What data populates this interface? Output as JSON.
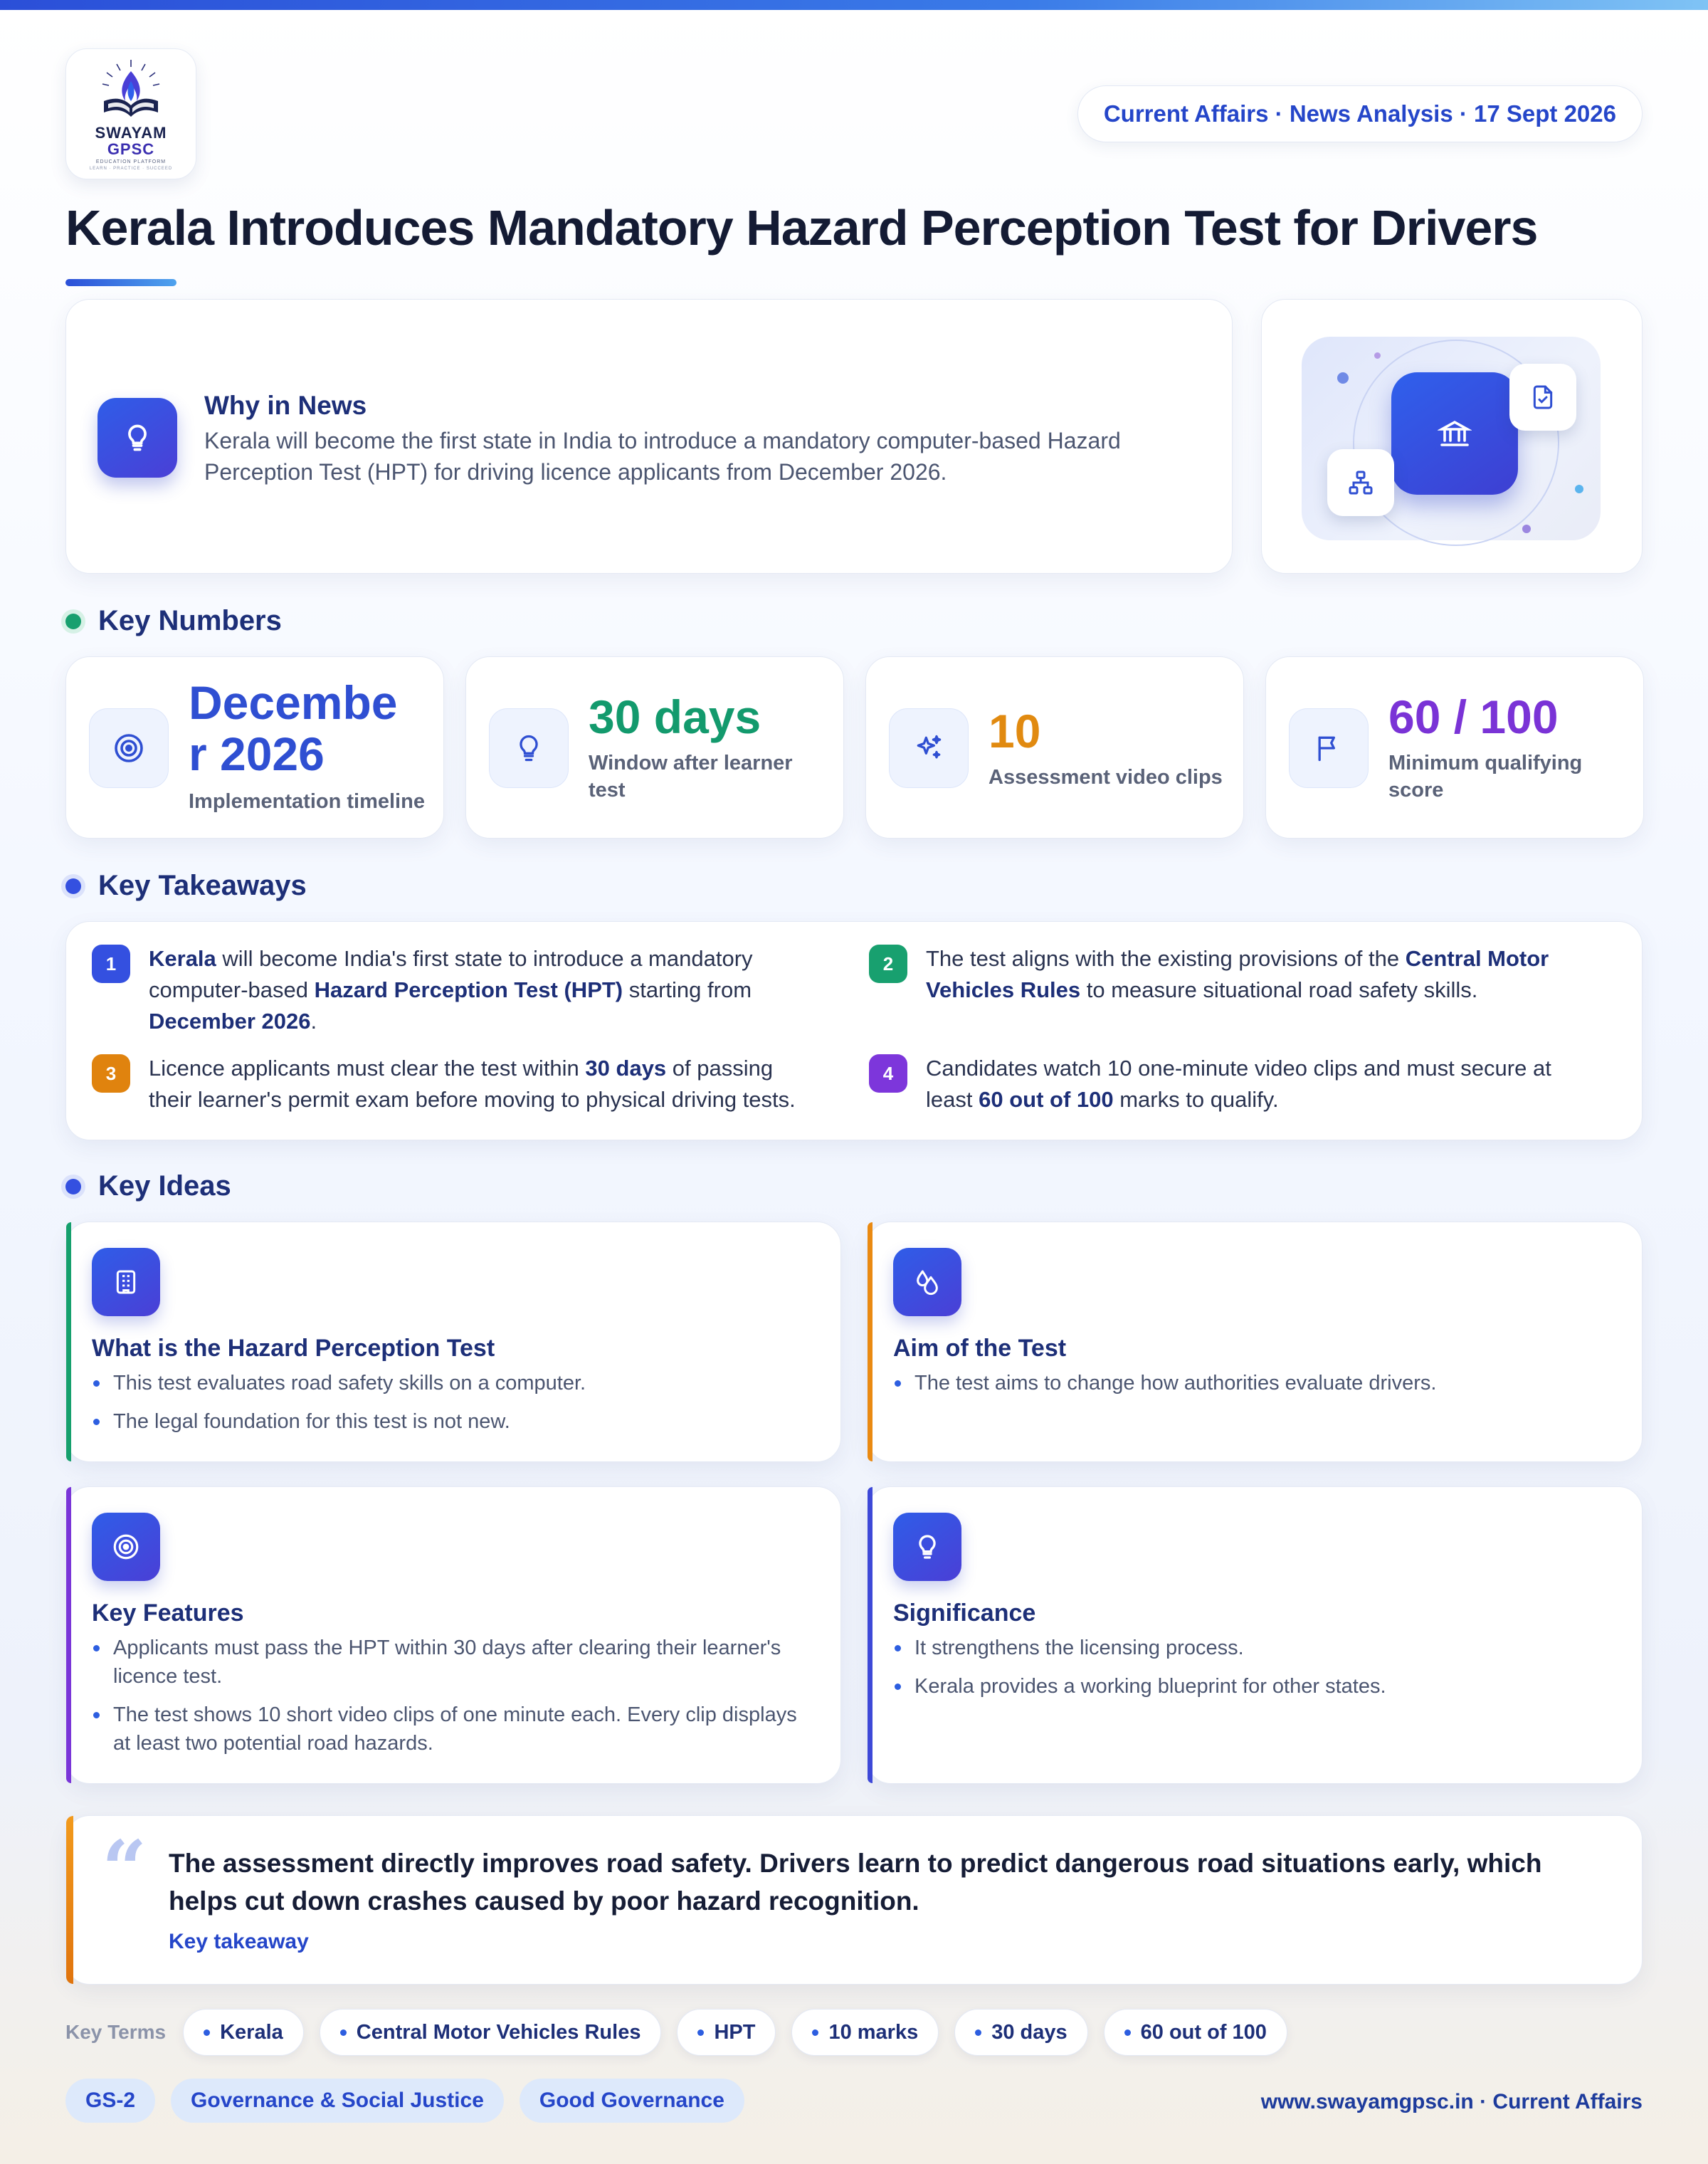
{
  "logo": {
    "line1": "SWAYAM",
    "line2": "GPSC",
    "line3": "EDUCATION PLATFORM",
    "line4": "LEARN · PRACTICE · SUCCEED"
  },
  "header": {
    "pill": "Current Affairs · News Analysis · 17 Sept 2026",
    "title": "Kerala Introduces Mandatory Hazard Perception Test for Drivers"
  },
  "why": {
    "heading": "Why in News",
    "text": "Kerala will become the first state in India to introduce a mandatory computer-based Hazard Perception Test (HPT) for driving licence applicants from December 2026."
  },
  "sections": {
    "numbers": "Key Numbers",
    "takeaways": "Key Takeaways",
    "ideas": "Key Ideas"
  },
  "numbers": [
    {
      "value_line1": "Decembe",
      "value_line2": "r 2026",
      "caption": "Implementation timeline",
      "color": "#2f4fd2",
      "icon": "target-icon"
    },
    {
      "value": "30 days",
      "caption_line1": "Window after learner",
      "caption_line2": "test",
      "color": "#139a6d",
      "icon": "lightbulb-icon"
    },
    {
      "value": "10",
      "caption": "Assessment video clips",
      "color": "#e18a10",
      "icon": "sparkle-icon"
    },
    {
      "value": "60 / 100",
      "caption_line1": "Minimum qualifying",
      "caption_line2": "score",
      "color": "#7a33d6",
      "icon": "flag-icon"
    }
  ],
  "takeaways": [
    {
      "num": "1",
      "color": "#3450e0",
      "p1": "Kerala",
      "p2": " will become India's first state to introduce a mandatory",
      "p3": "computer-based ",
      "p4": "Hazard Perception Test (HPT)",
      "p5": " starting from",
      "p6": "December 2026",
      "p7": "."
    },
    {
      "num": "2",
      "color": "#18a06f",
      "p1": "The test aligns with the existing provisions of the ",
      "p2": "Central Motor",
      "p3": "Vehicles Rules",
      "p4": " to measure situational road safety skills."
    },
    {
      "num": "3",
      "color": "#e0830e",
      "p1": "Licence applicants must clear the test within ",
      "p2": "30 days",
      "p3": " of passing",
      "p4": "their learner's permit exam before moving to physical driving tests."
    },
    {
      "num": "4",
      "color": "#7d36db",
      "p1": "Candidates watch 10 one-minute video clips and must secure at",
      "p2": "least ",
      "p3": "60 out of 100",
      "p4": " marks to qualify."
    }
  ],
  "ideas": [
    {
      "title": "What is the Hazard Perception Test",
      "stripe": "#16a06d",
      "icon": "building-icon",
      "bullets": [
        "This test evaluates road safety skills on a computer.",
        "The legal foundation for this test is not new."
      ]
    },
    {
      "title": "Aim of the Test",
      "stripe": "#ea8a12",
      "icon": "drops-icon",
      "bullets": [
        "The test aims to change how authorities evaluate drivers."
      ]
    },
    {
      "title": "Key Features",
      "stripe": "#7a35d8",
      "icon": "target-icon",
      "bullets": [
        "Applicants must pass the HPT within 30 days after clearing their learner's licence test.",
        "The test shows 10 short video clips of one minute each. Every clip displays at least two potential road hazards."
      ]
    },
    {
      "title": "Significance",
      "stripe": "#3e49d8",
      "icon": "lightbulb-icon",
      "bullets": [
        "It strengthens the licensing process.",
        "Kerala provides a working blueprint for other states."
      ]
    }
  ],
  "quote": {
    "text": "The assessment directly improves road safety. Drivers learn to predict dangerous road situations early, which helps cut down crashes caused by poor hazard recognition.",
    "source": "Key takeaway"
  },
  "key_terms": {
    "label": "Key Terms",
    "items": [
      "Kerala",
      "Central Motor Vehicles Rules",
      "HPT",
      "10 marks",
      "30 days",
      "60 out of 100"
    ]
  },
  "tags": [
    "GS-2",
    "Governance & Social Justice",
    "Good Governance"
  ],
  "footer": "www.swayamgpsc.in · Current Affairs"
}
